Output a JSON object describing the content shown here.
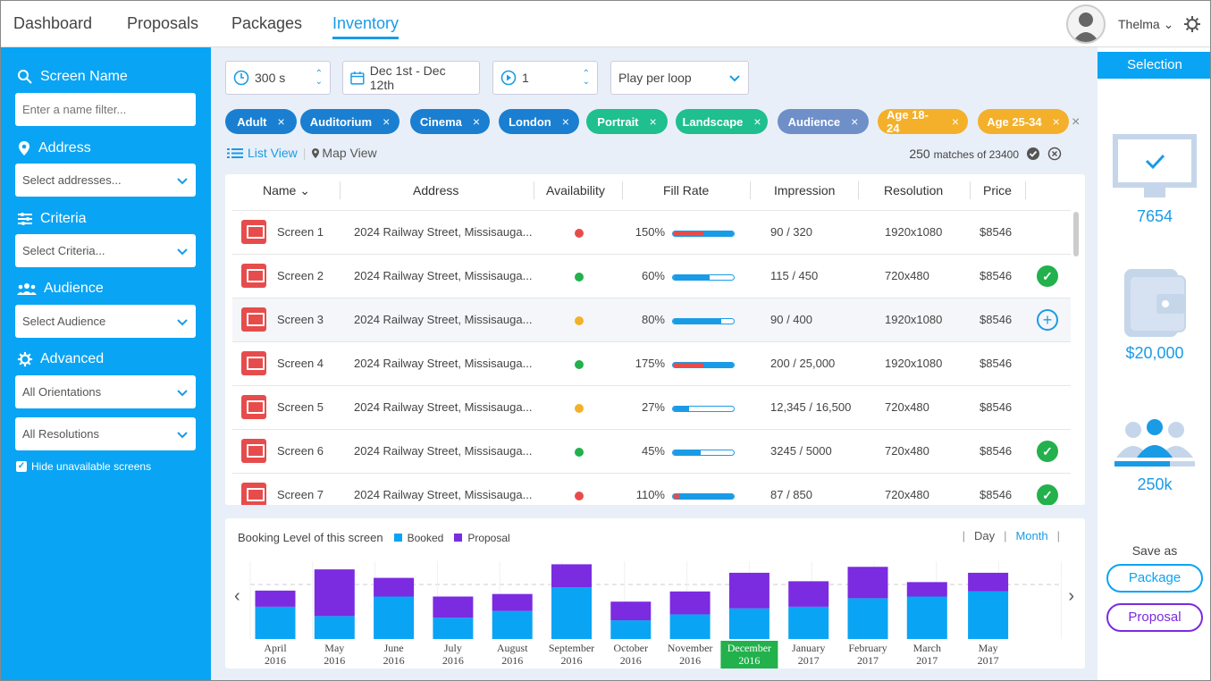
{
  "nav": {
    "tabs": [
      "Dashboard",
      "Proposals",
      "Packages",
      "Inventory"
    ],
    "active": "Inventory",
    "user": "Thelma"
  },
  "sidebar": {
    "screen_name": {
      "label": "Screen Name",
      "placeholder": "Enter a name filter..."
    },
    "address": {
      "label": "Address",
      "value": "Select addresses..."
    },
    "criteria": {
      "label": "Criteria",
      "value": "Select Criteria..."
    },
    "audience": {
      "label": "Audience",
      "value": "Select Audience"
    },
    "advanced": {
      "label": "Advanced",
      "orientation": "All Orientations",
      "resolution": "All Resolutions"
    },
    "hide_unavailable": "Hide unavailable screens"
  },
  "controls": {
    "duration": "300 s",
    "dates": "Dec 1st - Dec 12th",
    "loops": "1",
    "play": "Play per loop"
  },
  "chips": [
    {
      "label": "Adult",
      "color": "#1a7fd1"
    },
    {
      "label": "Auditorium",
      "color": "#1a7fd1"
    },
    {
      "label": "Cinema",
      "color": "#1a7fd1"
    },
    {
      "label": "London",
      "color": "#1a7fd1"
    },
    {
      "label": "Portrait",
      "color": "#1fbf8f"
    },
    {
      "label": "Landscape",
      "color": "#1fbf8f"
    },
    {
      "label": "Audience",
      "color": "#6f8fc9"
    },
    {
      "label": "Age 18-24",
      "color": "#f4b02a"
    },
    {
      "label": "Age 25-34",
      "color": "#f4b02a"
    }
  ],
  "views": {
    "list": "List View",
    "map": "Map View"
  },
  "matches": {
    "count": "250",
    "of": "matches of 23400"
  },
  "table": {
    "headers": [
      "Name",
      "Address",
      "Availability",
      "Fill Rate",
      "Impression",
      "Resolution",
      "Price"
    ],
    "rows": [
      {
        "name": "Screen 1",
        "address": "2024 Railway Street, Missisauga...",
        "avail": "#e74c4c",
        "fill": "150%",
        "fill_pct": 150,
        "imp": "90 / 320",
        "res": "1920x1080",
        "price": "$8546",
        "action": ""
      },
      {
        "name": "Screen 2",
        "address": "2024 Railway Street, Missisauga...",
        "avail": "#22b14c",
        "fill": "60%",
        "fill_pct": 60,
        "imp": "115 / 450",
        "res": "720x480",
        "price": "$8546",
        "action": "check"
      },
      {
        "name": "Screen 3",
        "address": "2024 Railway Street, Missisauga...",
        "avail": "#f4b02a",
        "fill": "80%",
        "fill_pct": 80,
        "imp": "90 / 400",
        "res": "1920x1080",
        "price": "$8546",
        "action": "add"
      },
      {
        "name": "Screen 4",
        "address": "2024 Railway Street, Missisauga...",
        "avail": "#22b14c",
        "fill": "175%",
        "fill_pct": 175,
        "imp": "200 / 25,000",
        "res": "1920x1080",
        "price": "$8546",
        "action": ""
      },
      {
        "name": "Screen 5",
        "address": "2024 Railway Street, Missisauga...",
        "avail": "#f4b02a",
        "fill": "27%",
        "fill_pct": 27,
        "imp": "12,345 / 16,500",
        "res": "720x480",
        "price": "$8546",
        "action": ""
      },
      {
        "name": "Screen 6",
        "address": "2024 Railway Street, Missisauga...",
        "avail": "#22b14c",
        "fill": "45%",
        "fill_pct": 45,
        "imp": "3245 / 5000",
        "res": "720x480",
        "price": "$8546",
        "action": "check"
      },
      {
        "name": "Screen 7",
        "address": "2024 Railway Street, Missisauga...",
        "avail": "#e74c4c",
        "fill": "110%",
        "fill_pct": 110,
        "imp": "87 / 850",
        "res": "720x480",
        "price": "$8546",
        "action": "check"
      }
    ]
  },
  "chart_data": {
    "type": "bar",
    "title": "Booking Level of this screen",
    "legend": [
      "Booked",
      "Proposal"
    ],
    "toggle": [
      "Day",
      "Month"
    ],
    "categories": [
      [
        "April",
        "2016"
      ],
      [
        "May",
        "2016"
      ],
      [
        "June",
        "2016"
      ],
      [
        "July",
        "2016"
      ],
      [
        "August",
        "2016"
      ],
      [
        "September",
        "2016"
      ],
      [
        "October",
        "2016"
      ],
      [
        "November",
        "2016"
      ],
      [
        "December",
        "2016"
      ],
      [
        "January",
        "2017"
      ],
      [
        "February",
        "2017"
      ],
      [
        "March",
        "2017"
      ],
      [
        "May",
        "2017"
      ]
    ],
    "series": [
      {
        "name": "Booked",
        "color": "#0aa4f4",
        "values": [
          38,
          27,
          50,
          25,
          33,
          61,
          22,
          29,
          36,
          38,
          48,
          50,
          56
        ]
      },
      {
        "name": "Proposal",
        "color": "#7b2be0",
        "values": [
          19,
          55,
          22,
          25,
          20,
          27,
          22,
          27,
          42,
          30,
          37,
          17,
          22
        ]
      }
    ],
    "highlight": "December",
    "ylim": [
      0,
      100
    ]
  },
  "selection": {
    "title": "Selection",
    "screens": "7654",
    "budget": "$20,000",
    "audience": "250k",
    "save_as": "Save as",
    "package": "Package",
    "proposal": "Proposal"
  }
}
